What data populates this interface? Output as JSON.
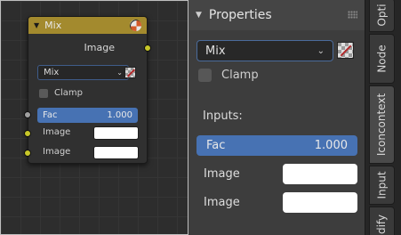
{
  "node": {
    "title": "Mix",
    "output_label": "Image",
    "blend_mode": "Mix",
    "clamp_label": "Clamp",
    "fac_label": "Fac",
    "fac_value": "1.000",
    "input1_label": "Image",
    "input2_label": "Image",
    "input1_color": "#ffffff",
    "input2_color": "#ffffff",
    "header_color": "#a38a2e"
  },
  "panel": {
    "header": "Properties",
    "blend_mode": "Mix",
    "clamp_label": "Clamp",
    "inputs_label": "Inputs:",
    "fac_label": "Fac",
    "fac_value": "1.000",
    "input1_label": "Image",
    "input2_label": "Image",
    "accent_color": "#4772b3"
  },
  "tabs": [
    "Opti",
    "Node",
    "Iconcontext",
    "Input",
    "dify"
  ],
  "icons": {
    "collapse": "triangle-down-icon",
    "node_header": "mix-node-icon",
    "checker": "checkerboard-icon",
    "chevron": "chevron-down-icon",
    "drag": "drag-handle-icon"
  }
}
